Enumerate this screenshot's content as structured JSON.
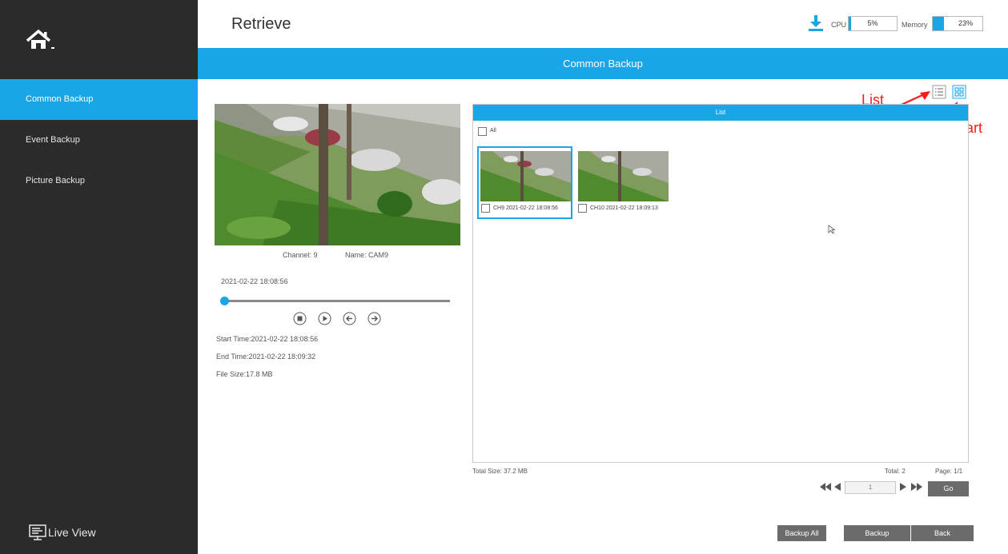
{
  "sidebar": {
    "items": [
      {
        "label": "Common Backup"
      },
      {
        "label": "Event Backup"
      },
      {
        "label": "Picture Backup"
      }
    ],
    "live_view_label": "Live View"
  },
  "header": {
    "title": "Retrieve",
    "cpu_label": "CPU",
    "cpu_value": "5%",
    "cpu_fraction": 0.05,
    "memory_label": "Memory",
    "memory_value": "23%",
    "memory_fraction": 0.23
  },
  "banner": {
    "label": "Common Backup"
  },
  "annotations": {
    "list_label": "List",
    "chart_label": "Chart",
    "color": "#ff1a1a"
  },
  "preview": {
    "channel": "Channel: 9",
    "name": "Name: CAM9",
    "current_time": "2021-02-22 18:08:56",
    "progress": 0.0,
    "start_time": "Start Time:2021-02-22 18:08:56",
    "end_time": "End Time:2021-02-22 18:09:32",
    "file_size": "File Size:17.8 MB"
  },
  "list": {
    "header": "List",
    "all_label": "All",
    "items": [
      {
        "label": "CH9  2021-02-22 18:08:56",
        "selected": true
      },
      {
        "label": "CH10  2021-02-22 18:09:13",
        "selected": false
      }
    ]
  },
  "footer": {
    "total_size": "Total Size: 37.2 MB",
    "total": "Total: 2",
    "page": "Page: 1/1",
    "page_input": "1",
    "go_label": "Go"
  },
  "buttons": {
    "backup_all": "Backup All",
    "backup": "Backup",
    "back": "Back"
  },
  "colors": {
    "accent": "#1aa5e6",
    "sidebar": "#2b2b2b",
    "button": "#6b6b6b"
  }
}
